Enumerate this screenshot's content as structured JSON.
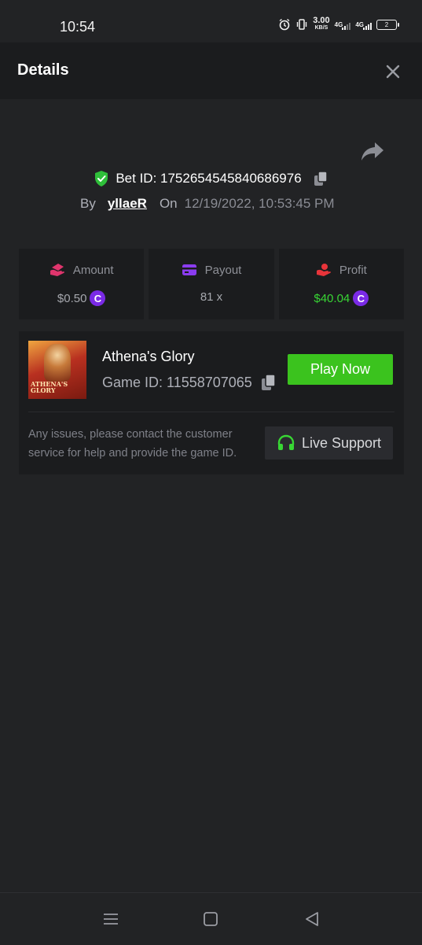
{
  "status_bar": {
    "time": "10:54",
    "speed_value": "3.00",
    "speed_unit": "KB/S",
    "network_1": "4G",
    "network_2": "4G",
    "battery": "2"
  },
  "header": {
    "title": "Details",
    "close_icon": "close-icon"
  },
  "bet": {
    "id_label": "Bet ID: 1752654545840686976",
    "by_label": "By",
    "username": "yllaeR",
    "on_label": "On",
    "datetime": "12/19/2022, 10:53:45 PM"
  },
  "stats": {
    "amount": {
      "label": "Amount",
      "value": "$0.50",
      "icon": "money-hand-icon"
    },
    "payout": {
      "label": "Payout",
      "value": "81 x",
      "icon": "card-icon"
    },
    "profit": {
      "label": "Profit",
      "value": "$40.04",
      "icon": "coins-hand-icon"
    },
    "coin_symbol": "C"
  },
  "game": {
    "title": "Athena's Glory",
    "id_label": "Game ID: 11558707065",
    "thumbnail_text": "ATHENA'S GLORY",
    "play_label": "Play Now",
    "support_text": "Any issues, please contact the customer service for help and provide the game ID.",
    "support_label": "Live Support"
  },
  "colors": {
    "accent_green": "#3bc31e",
    "profit_green": "#38d634",
    "coin_purple": "#7a2ae6",
    "shield_green": "#2fbf3a"
  }
}
